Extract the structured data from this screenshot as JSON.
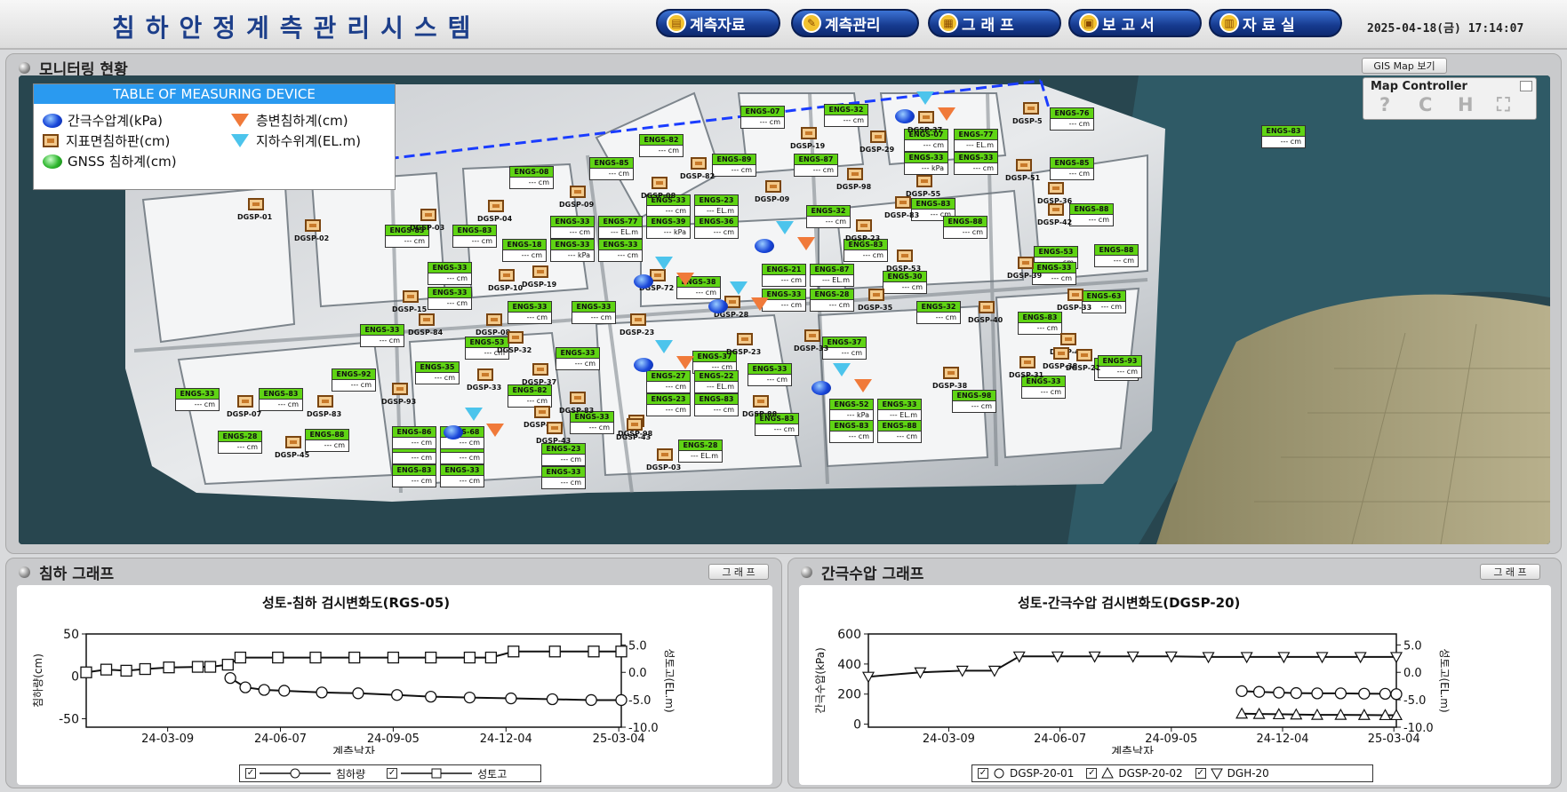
{
  "header": {
    "title": "침하안정계측관리시스템",
    "nav": [
      {
        "label": "계측자료",
        "icon": "folder-icon"
      },
      {
        "label": "계측관리",
        "icon": "tools-icon"
      },
      {
        "label": "그 래 프",
        "icon": "chart-icon"
      },
      {
        "label": "보 고 서",
        "icon": "report-icon"
      },
      {
        "label": "자 료 실",
        "icon": "archive-icon"
      }
    ],
    "datetime": "2025-04-18(금) 17:14:07"
  },
  "monitoring": {
    "title": "모니터링 현황",
    "gis_button": "GIS Map 보기",
    "map_controller": {
      "title": "Map Controller",
      "tools": [
        "?",
        "C",
        "H",
        "⛶"
      ]
    },
    "legend": {
      "title": "TABLE OF MEASURING DEVICE",
      "items": [
        {
          "label": "간극수압계(kPa)",
          "icon": "piezometer-circle-icon"
        },
        {
          "label": "층변침하계(cm)",
          "icon": "layer-settlement-triangle-icon"
        },
        {
          "label": "지표면침하판(cm)",
          "icon": "settlement-plate-square-icon"
        },
        {
          "label": "지하수위계(EL.m)",
          "icon": "groundwater-triangle-icon"
        },
        {
          "label": "GNSS 침하계(cm)",
          "icon": "gnss-circle-icon"
        }
      ]
    },
    "sensors": [
      {
        "name": "ENGS-07",
        "value": "--- cm"
      },
      {
        "name": "ENGS-32",
        "value": "--- cm"
      },
      {
        "name": "ENGS-07",
        "value": "--- cm"
      },
      {
        "name": "ENGS-77",
        "value": "--- EL.m"
      },
      {
        "name": "ENGS-33",
        "value": "--- kPa"
      },
      {
        "name": "ENGS-33",
        "value": "--- cm"
      },
      {
        "name": "ENGS-76",
        "value": "--- cm"
      },
      {
        "name": "ENGS-83",
        "value": "--- cm"
      },
      {
        "name": "ENGS-82",
        "value": "--- cm"
      },
      {
        "name": "ENGS-85",
        "value": "--- cm"
      },
      {
        "name": "ENGS-89",
        "value": "--- cm"
      },
      {
        "name": "ENGS-87",
        "value": "--- cm"
      },
      {
        "name": "ENGS-85",
        "value": "--- cm"
      },
      {
        "name": "ENGS-08",
        "value": "--- cm"
      },
      {
        "name": "ENGS-33",
        "value": "--- cm"
      },
      {
        "name": "ENGS-23",
        "value": "--- EL.m"
      },
      {
        "name": "ENGS-88",
        "value": "--- cm"
      },
      {
        "name": "ENGS-32",
        "value": "--- cm"
      },
      {
        "name": "ENGS-83",
        "value": "--- cm"
      },
      {
        "name": "ENGS-88",
        "value": "--- cm"
      },
      {
        "name": "ENGS-83",
        "value": "--- cm"
      },
      {
        "name": "ENGS-83",
        "value": "--- cm"
      },
      {
        "name": "ENGS-33",
        "value": "--- cm"
      },
      {
        "name": "ENGS-77",
        "value": "--- EL.m"
      },
      {
        "name": "ENGS-39",
        "value": "--- kPa"
      },
      {
        "name": "ENGS-36",
        "value": "--- cm"
      },
      {
        "name": "ENGS-18",
        "value": "--- cm"
      },
      {
        "name": "ENGS-33",
        "value": "--- kPa"
      },
      {
        "name": "ENGS-33",
        "value": "--- cm"
      },
      {
        "name": "ENGS-83",
        "value": "--- cm"
      },
      {
        "name": "ENGS-33",
        "value": "--- cm"
      },
      {
        "name": "ENGS-53",
        "value": "--- cm"
      },
      {
        "name": "ENGS-63",
        "value": "--- cm"
      },
      {
        "name": "ENGS-33",
        "value": "--- cm"
      },
      {
        "name": "ENGS-30",
        "value": "--- cm"
      },
      {
        "name": "ENGS-21",
        "value": "--- cm"
      },
      {
        "name": "ENGS-87",
        "value": "--- EL.m"
      },
      {
        "name": "ENGS-38",
        "value": "--- cm"
      },
      {
        "name": "ENGS-33",
        "value": "--- cm"
      },
      {
        "name": "ENGS-28",
        "value": "--- cm"
      },
      {
        "name": "ENGS-33",
        "value": "--- cm"
      },
      {
        "name": "ENGS-33",
        "value": "--- cm"
      },
      {
        "name": "ENGS-32",
        "value": "--- cm"
      },
      {
        "name": "ENGS-83",
        "value": "--- cm"
      },
      {
        "name": "ENGS-33",
        "value": "--- cm"
      },
      {
        "name": "ENGS-53",
        "value": "--- cm"
      },
      {
        "name": "ENGS-83",
        "value": "--- cm"
      },
      {
        "name": "ENGS-35",
        "value": "--- cm"
      },
      {
        "name": "ENGS-33",
        "value": "--- cm"
      },
      {
        "name": "ENGS-37",
        "value": "--- cm"
      },
      {
        "name": "ENGS-33",
        "value": "--- cm"
      },
      {
        "name": "ENGS-37",
        "value": "--- cm"
      },
      {
        "name": "ENGS-33",
        "value": "--- cm"
      },
      {
        "name": "ENGS-83",
        "value": "--- cm"
      },
      {
        "name": "ENGS-92",
        "value": "--- cm"
      },
      {
        "name": "ENGS-33",
        "value": "--- cm"
      },
      {
        "name": "ENGS-27",
        "value": "--- cm"
      },
      {
        "name": "ENGS-22",
        "value": "--- EL.m"
      },
      {
        "name": "ENGS-23",
        "value": "--- cm"
      },
      {
        "name": "ENGS-83",
        "value": "--- cm"
      },
      {
        "name": "ENGS-52",
        "value": "--- kPa"
      },
      {
        "name": "ENGS-33",
        "value": "--- EL.m"
      },
      {
        "name": "ENGS-83",
        "value": "--- cm"
      },
      {
        "name": "ENGS-88",
        "value": "--- cm"
      },
      {
        "name": "ENGS-82",
        "value": "--- cm"
      },
      {
        "name": "ENGS-98",
        "value": "--- cm"
      },
      {
        "name": "ENGS-33",
        "value": "--- cm"
      },
      {
        "name": "ENGS-83",
        "value": "--- cm"
      },
      {
        "name": "ENGS-33",
        "value": "--- cm"
      },
      {
        "name": "ENGS-33",
        "value": "--- cm"
      },
      {
        "name": "ENGS-83",
        "value": "--- cm"
      },
      {
        "name": "ENGS-33",
        "value": "--- cm"
      },
      {
        "name": "ENGS-23",
        "value": "--- cm"
      },
      {
        "name": "ENGS-28",
        "value": "--- EL.m"
      },
      {
        "name": "ENGS-28",
        "value": "--- cm"
      },
      {
        "name": "ENGS-88",
        "value": "--- cm"
      },
      {
        "name": "ENGS-86",
        "value": "--- cm"
      },
      {
        "name": "ENGS-68",
        "value": "--- cm"
      },
      {
        "name": "ENGS-33",
        "value": "--- cm"
      },
      {
        "name": "ENGS-93",
        "value": "--- cm"
      },
      {
        "name": "ENGS-33",
        "value": "--- cm"
      },
      {
        "name": "ENGS-88",
        "value": "--- cm"
      }
    ],
    "plates": [
      "DGSP-01",
      "DGSP-02",
      "DGSP-03",
      "DGSP-04",
      "DGSP-09",
      "DGSP-08",
      "DGSP-82",
      "DGSP-09",
      "DGSP-19",
      "DGSP-29",
      "DGSP-98",
      "DGSP-37",
      "DGSP-55",
      "DGSP-5",
      "DGSP-51",
      "DGSP-36",
      "DGSP-42",
      "DGSP-23",
      "DGSP-83",
      "DGSP-53",
      "DGSP-39",
      "DGSP-33",
      "DGSP-35",
      "DGSP-10",
      "DGSP-19",
      "DGSP-15",
      "DGSP-72",
      "DGSP-28",
      "DGSP-40",
      "DGSP-47",
      "DGSP-08",
      "DGSP-32",
      "DGSP-23",
      "DGSP-23",
      "DGSP-33",
      "DGSP-31",
      "DGSP-38",
      "DGSP-38",
      "DGSP-37",
      "DGSP-83",
      "DGSP-93",
      "DGSP-33",
      "DGSP-04",
      "DGSP-98",
      "DGSP-88",
      "DGSP-07",
      "DGSP-83",
      "DGSP-43",
      "DGSP-43",
      "DGSP-03",
      "DGSP-45",
      "DGSP-84",
      "DGSP-21"
    ]
  },
  "settlement_panel": {
    "title": "침하 그래프",
    "button": "그 래 프",
    "chart_title": "성토-침하 검시변화도(RGS-05)",
    "xlabel": "계측날자",
    "ylabel_left": "침하량(cm)",
    "ylabel_right": "성토고(EL.m)",
    "legend": [
      "침하량",
      "성토고"
    ]
  },
  "pore_panel": {
    "title": "간극수압 그래프",
    "button": "그 래 프",
    "chart_title": "성토-간극수압 검시변화도(DGSP-20)",
    "xlabel": "계측날자",
    "ylabel_left": "간극수압(kPa)",
    "ylabel_right": "성토고(EL.m)",
    "legend": [
      "DGSP-20-01",
      "DGSP-20-02",
      "DGH-20"
    ]
  },
  "chart_data": [
    {
      "type": "line",
      "title": "성토-침하 검시변화도(RGS-05)",
      "xlabel": "계측날자",
      "ylabel": "침하량(cm)",
      "y2label": "성토고(EL.m)",
      "x_ticks": [
        "24-03-09",
        "24-06-07",
        "24-09-05",
        "24-12-04",
        "25-03-04"
      ],
      "xlim": [
        "2024-01-04",
        "2025-03-06"
      ],
      "ylim": [
        -60,
        50
      ],
      "y_ticks": [
        -50,
        0,
        50
      ],
      "y2lim": [
        -10,
        7
      ],
      "y2_ticks": [
        -10.0,
        -5.0,
        0.0,
        5.0
      ],
      "grid": false,
      "legend_position": "bottom",
      "series": [
        {
          "name": "침하량",
          "axis": "left",
          "marker": "circle",
          "x": [
            "2024-04-28",
            "2024-05-10",
            "2024-05-25",
            "2024-06-10",
            "2024-07-10",
            "2024-08-08",
            "2024-09-08",
            "2024-10-05",
            "2024-11-05",
            "2024-12-08",
            "2025-01-10",
            "2025-02-10",
            "2025-03-06"
          ],
          "y": [
            -2,
            -13,
            -16,
            -17,
            -19,
            -20,
            -22,
            -24,
            -25,
            -26,
            -27,
            -28,
            -28
          ]
        },
        {
          "name": "성토고",
          "axis": "right",
          "marker": "square",
          "x": [
            "2024-01-04",
            "2024-01-20",
            "2024-02-05",
            "2024-02-20",
            "2024-03-10",
            "2024-04-02",
            "2024-04-12",
            "2024-04-26",
            "2024-05-06",
            "2024-06-05",
            "2024-07-05",
            "2024-08-05",
            "2024-09-05",
            "2024-10-05",
            "2024-11-05",
            "2024-11-22",
            "2024-12-10",
            "2025-01-12",
            "2025-02-12",
            "2025-03-06"
          ],
          "y": [
            0.0,
            0.5,
            0.3,
            0.6,
            0.9,
            1.0,
            1.0,
            1.4,
            2.7,
            2.7,
            2.7,
            2.7,
            2.7,
            2.7,
            2.7,
            2.7,
            3.8,
            3.8,
            3.8,
            3.8
          ]
        }
      ]
    },
    {
      "type": "line",
      "title": "성토-간극수압 검시변화도(DGSP-20)",
      "xlabel": "계측날자",
      "ylabel": "간극수압(kPa)",
      "y2label": "성토고(EL.m)",
      "x_ticks": [
        "24-03-09",
        "24-06-07",
        "24-09-05",
        "24-12-04",
        "25-03-04"
      ],
      "xlim": [
        "2024-01-04",
        "2025-03-06"
      ],
      "ylim": [
        -20,
        600
      ],
      "y_ticks": [
        0,
        200,
        400,
        600
      ],
      "y2lim": [
        -10,
        7
      ],
      "y2_ticks": [
        -10.0,
        -5.0,
        0.0,
        5.0
      ],
      "grid": false,
      "legend_position": "bottom",
      "series": [
        {
          "name": "DGSP-20-01",
          "axis": "left",
          "marker": "circle",
          "x": [
            "2024-11-01",
            "2024-11-15",
            "2024-12-01",
            "2024-12-15",
            "2025-01-01",
            "2025-01-20",
            "2025-02-08",
            "2025-02-25",
            "2025-03-06"
          ],
          "y": [
            220,
            215,
            210,
            207,
            205,
            205,
            203,
            202,
            200
          ]
        },
        {
          "name": "DGSP-20-02",
          "axis": "left",
          "marker": "triangle-up",
          "x": [
            "2024-11-01",
            "2024-11-15",
            "2024-12-01",
            "2024-12-15",
            "2025-01-01",
            "2025-01-20",
            "2025-02-08",
            "2025-02-25",
            "2025-03-06"
          ],
          "y": [
            70,
            68,
            66,
            64,
            62,
            62,
            61,
            60,
            60
          ]
        },
        {
          "name": "DGH-20",
          "axis": "right",
          "marker": "triangle-down",
          "x": [
            "2024-01-04",
            "2024-02-15",
            "2024-03-20",
            "2024-04-15",
            "2024-05-05",
            "2024-06-05",
            "2024-07-05",
            "2024-08-05",
            "2024-09-05",
            "2024-10-05",
            "2024-11-05",
            "2024-12-05",
            "2025-01-05",
            "2025-02-05",
            "2025-03-06"
          ],
          "y": [
            -0.8,
            0.0,
            0.3,
            0.3,
            2.9,
            2.9,
            2.9,
            2.9,
            2.9,
            2.8,
            2.8,
            2.8,
            2.8,
            2.8,
            2.8
          ]
        }
      ]
    }
  ]
}
